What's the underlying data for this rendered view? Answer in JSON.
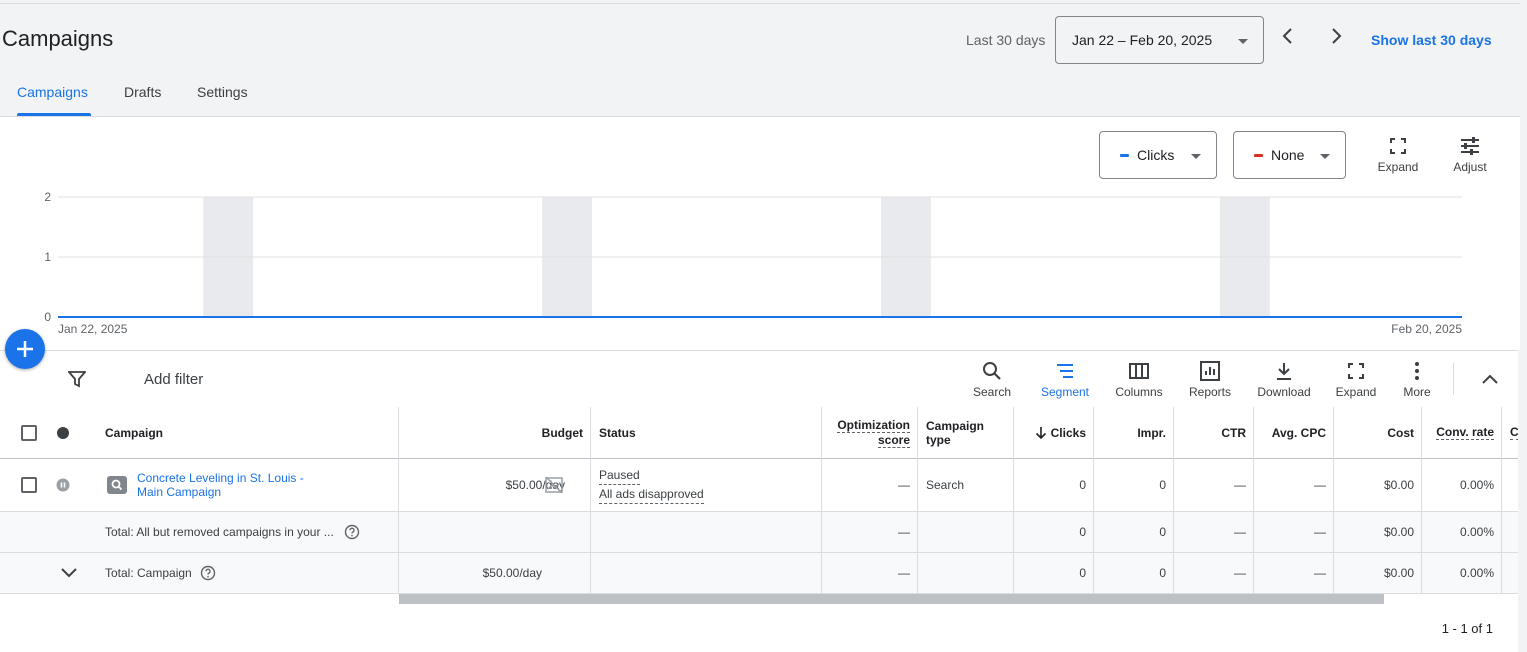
{
  "header": {
    "title": "Campaigns",
    "range_label": "Last 30 days",
    "date_range": "Jan 22 – Feb 20, 2025",
    "show_last": "Show last 30 days"
  },
  "tabs": [
    {
      "label": "Campaigns",
      "active": true
    },
    {
      "label": "Drafts",
      "active": false
    },
    {
      "label": "Settings",
      "active": false
    }
  ],
  "chart_controls": {
    "metric1": {
      "label": "Clicks",
      "color": "#1a73e8"
    },
    "metric2": {
      "label": "None",
      "color": "#d93025"
    },
    "expand": "Expand",
    "adjust": "Adjust"
  },
  "chart_data": {
    "type": "line",
    "x_start_label": "Jan 22, 2025",
    "x_end_label": "Feb 20, 2025",
    "y_ticks": [
      "2",
      "1",
      "0"
    ],
    "ylim": [
      0,
      2
    ],
    "series": [
      {
        "name": "Clicks",
        "color": "#1a73e8",
        "values": [
          0,
          0,
          0,
          0,
          0,
          0,
          0,
          0,
          0,
          0,
          0,
          0,
          0,
          0,
          0,
          0,
          0,
          0,
          0,
          0,
          0,
          0,
          0,
          0,
          0,
          0,
          0,
          0,
          0,
          0
        ]
      }
    ],
    "grid": true,
    "weekend_bands": true
  },
  "toolbar": {
    "add_filter": "Add filter",
    "search": "Search",
    "segment": "Segment",
    "columns": "Columns",
    "reports": "Reports",
    "download": "Download",
    "expand": "Expand",
    "more": "More"
  },
  "table": {
    "headers": {
      "campaign": "Campaign",
      "budget": "Budget",
      "status": "Status",
      "opt_score_1": "Optimization",
      "opt_score_2": "score",
      "type_1": "Campaign",
      "type_2": "type",
      "clicks": "Clicks",
      "impr": "Impr.",
      "ctr": "CTR",
      "avg_cpc": "Avg. CPC",
      "cost": "Cost",
      "conv_rate": "Conv. rate",
      "cut": "C"
    },
    "row": {
      "name_1": "Concrete Leveling in St. Louis -",
      "name_2": "Main Campaign",
      "budget": "$50.00/day",
      "status": "Paused",
      "status_detail": "All ads disapproved",
      "opt_score": "—",
      "type": "Search",
      "clicks": "0",
      "impr": "0",
      "ctr": "—",
      "avg_cpc": "—",
      "cost": "$0.00",
      "conv_rate": "0.00%"
    },
    "total_all": {
      "label": "Total: All but removed campaigns in your ...",
      "opt_score": "—",
      "clicks": "0",
      "impr": "0",
      "ctr": "—",
      "avg_cpc": "—",
      "cost": "$0.00",
      "conv_rate": "0.00%"
    },
    "total_campaign": {
      "label": "Total: Campaign",
      "budget": "$50.00/day",
      "opt_score": "—",
      "clicks": "0",
      "impr": "0",
      "ctr": "—",
      "avg_cpc": "—",
      "cost": "$0.00",
      "conv_rate": "0.00%"
    }
  },
  "pager": "1 - 1 of 1"
}
